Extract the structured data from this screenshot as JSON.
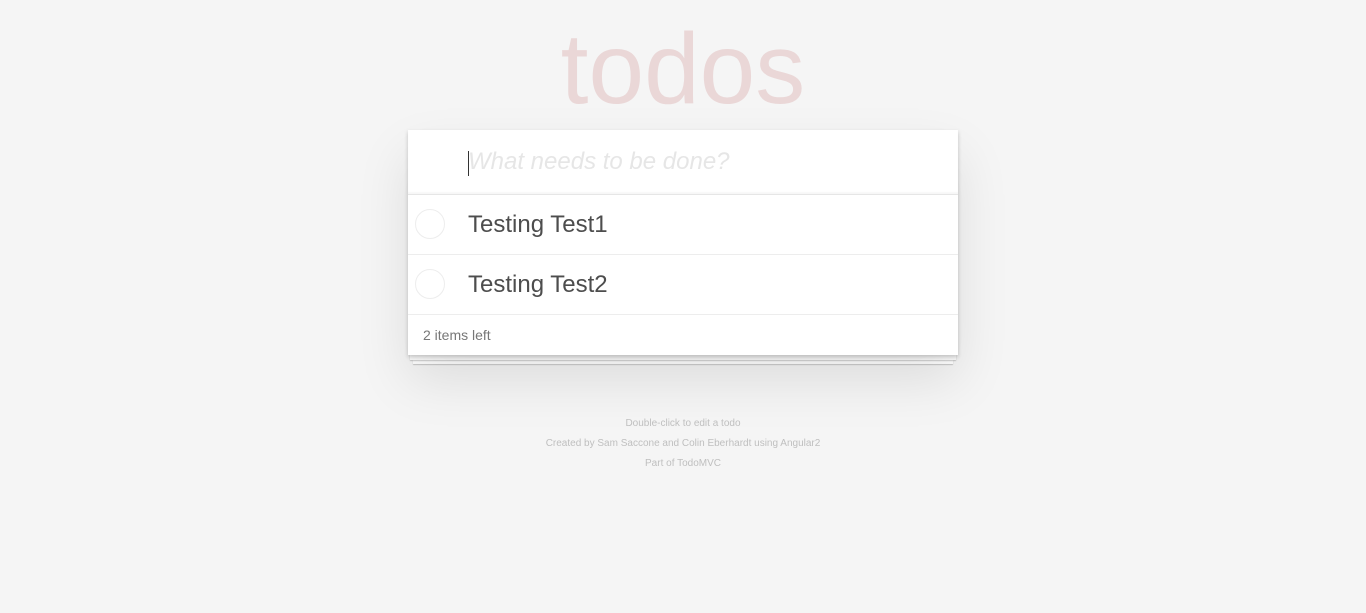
{
  "header": {
    "title": "todos"
  },
  "new_todo": {
    "placeholder": "What needs to be done?",
    "value": ""
  },
  "todos": [
    {
      "label": "Testing Test1",
      "completed": false
    },
    {
      "label": "Testing Test2",
      "completed": false
    }
  ],
  "footer": {
    "count_text": "2 items left"
  },
  "info": {
    "line1": "Double-click to edit a todo",
    "line2": "Created by Sam Saccone and Colin Eberhardt using Angular2",
    "line3": "Part of TodoMVC"
  },
  "colors": {
    "background": "#f5f5f5",
    "title": "#eaD7d7",
    "text": "#4d4d4d",
    "placeholder": "#e6e6e6",
    "info": "#bfbfbf"
  }
}
